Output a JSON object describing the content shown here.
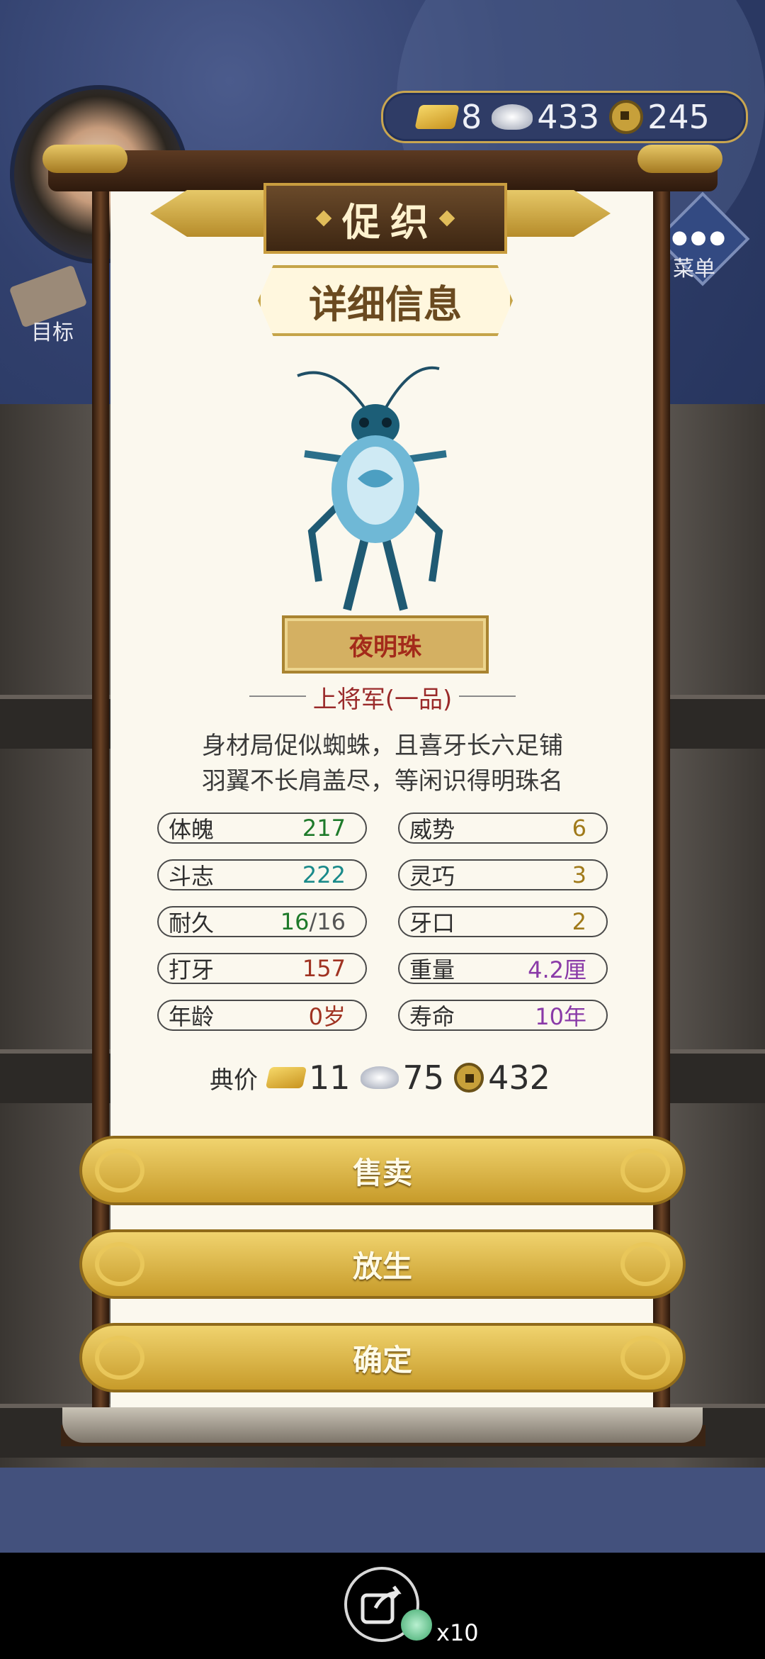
{
  "currency": {
    "gold": "8",
    "silver": "433",
    "coin": "245"
  },
  "side": {
    "goal_label": "目标",
    "menu_label": "菜单"
  },
  "panel": {
    "title": "促织",
    "subtitle": "详细信息",
    "insect_name": "夜明珠",
    "rank": "上将军(一品)",
    "description_lines": [
      "身材局促似蜘蛛，且喜牙长六足铺",
      "羽翼不长肩盖尽，等闲识得明珠名"
    ]
  },
  "stats": {
    "left": [
      {
        "label": "体魄",
        "value": "217",
        "color": "#1e7a2a"
      },
      {
        "label": "斗志",
        "value": "222",
        "color": "#1a8a8a"
      },
      {
        "label": "耐久",
        "value": "16",
        "value_max": "/16",
        "color": "#1e7a2a"
      },
      {
        "label": "打牙",
        "value": "157",
        "color": "#a03322"
      },
      {
        "label": "年龄",
        "value": "0岁",
        "color": "#a03322"
      }
    ],
    "right": [
      {
        "label": "威势",
        "value": "6",
        "color": "#a07a1a"
      },
      {
        "label": "灵巧",
        "value": "3",
        "color": "#a07a1a"
      },
      {
        "label": "牙口",
        "value": "2",
        "color": "#a07a1a"
      },
      {
        "label": "重量",
        "value": "4.2厘",
        "color": "#8a3aa8"
      },
      {
        "label": "寿命",
        "value": "10年",
        "color": "#8a3aa8"
      }
    ]
  },
  "price": {
    "label": "典价",
    "gold": "11",
    "silver": "75",
    "coin": "432"
  },
  "buttons": {
    "sell": "售卖",
    "release": "放生",
    "confirm": "确定"
  },
  "share": {
    "count": "x10"
  }
}
